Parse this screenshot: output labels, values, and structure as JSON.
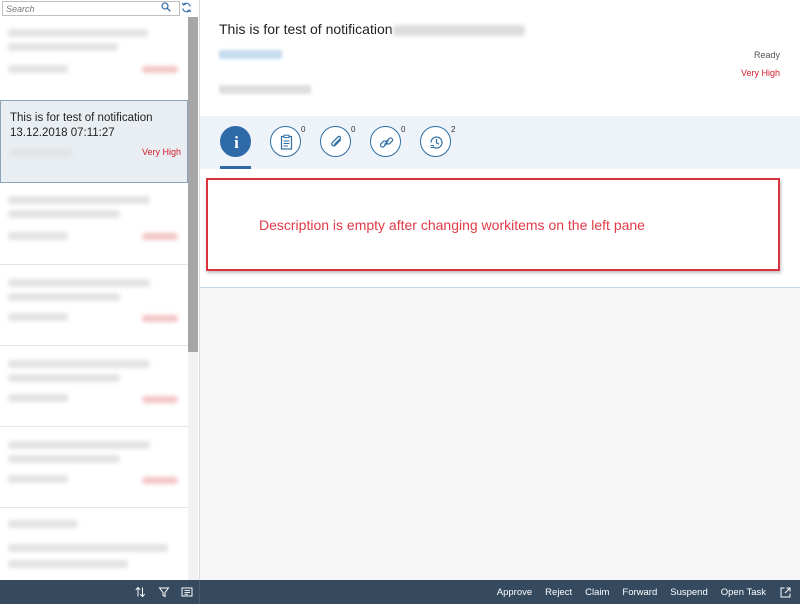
{
  "search": {
    "placeholder": "Search"
  },
  "selected_item": {
    "title": "This is for test of notification",
    "date": "13.12.2018 07:11:27",
    "priority": "Very High"
  },
  "detail": {
    "title": "This is for test of notification",
    "status": "Ready",
    "priority": "Very High"
  },
  "tabs": [
    {
      "name": "info",
      "count": ""
    },
    {
      "name": "notes",
      "count": "0"
    },
    {
      "name": "attachments",
      "count": "0"
    },
    {
      "name": "links",
      "count": "0"
    },
    {
      "name": "history",
      "count": "2"
    }
  ],
  "annotation": {
    "text": "Description is empty after changing workitems on the left pane"
  },
  "footer": {
    "actions": [
      "Approve",
      "Reject",
      "Claim",
      "Forward",
      "Suspend",
      "Open Task"
    ]
  },
  "colors": {
    "accent": "#2f6aa8",
    "priority": "#d32030",
    "footer_bg": "#354a5f",
    "annotation": "#d9323c"
  }
}
